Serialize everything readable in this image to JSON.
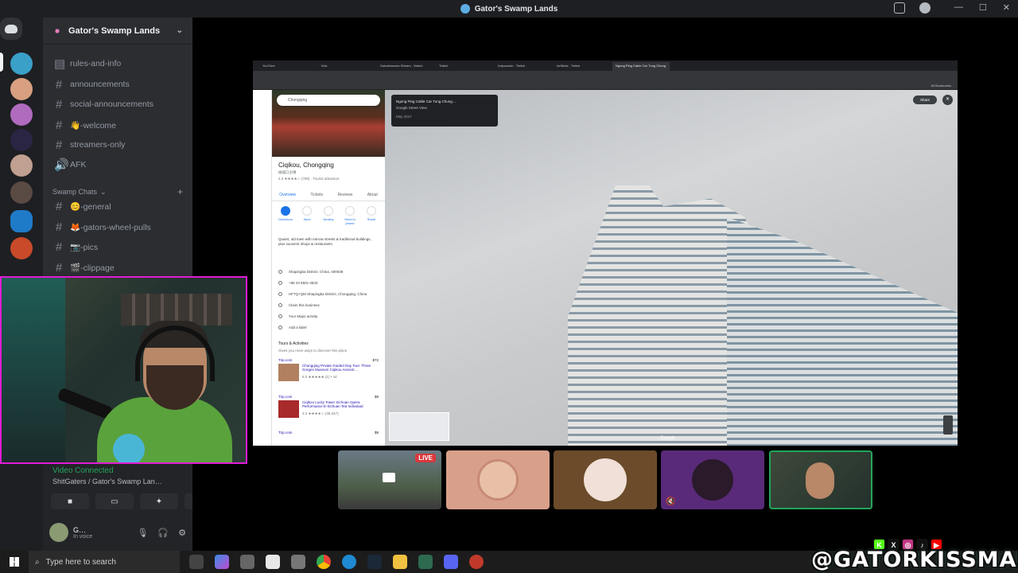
{
  "window": {
    "title": "Gator's Swamp Lands",
    "controls": [
      "—",
      "☐",
      "✕"
    ]
  },
  "server": {
    "name": "Gator's Swamp Lands"
  },
  "channels": [
    {
      "name": "rules-and-info",
      "icon": "hash"
    },
    {
      "name": "announcements",
      "icon": "hash"
    },
    {
      "name": "social-announcements",
      "icon": "hash"
    },
    {
      "name": "👋-welcome",
      "icon": "hash"
    },
    {
      "name": "streamers-only",
      "icon": "hash"
    },
    {
      "name": "AFK",
      "icon": "speaker"
    }
  ],
  "category": {
    "name": "Swamp Chats",
    "add": "+"
  },
  "category_channels": [
    {
      "name": "😊-general"
    },
    {
      "name": "🦊-gators-wheel-pulls"
    },
    {
      "name": "📷-pics"
    },
    {
      "name": "🎬-clippage"
    }
  ],
  "voice": {
    "status": "Video Connected",
    "location": "ShitGaters / Gator's Swamp Lan…",
    "user_name": "G…",
    "user_status": "In voice"
  },
  "browser": {
    "tabs": [
      "YouTube",
      "Kick",
      "Gatorkissman Stream - Watch",
      "Twitch",
      "hotpoussin - Twitch",
      "lurNkidz - Twitch",
      "Ngong Ping Cable Car Tung Chung"
    ],
    "bookmarks_hint": "All Bookmarks"
  },
  "maps": {
    "search_value": "Chongqing",
    "place_title": "Ciqikou, Chongqing",
    "place_subtitle": "磁器口古镇",
    "rating": "4.3 ★★★★☆ (789)",
    "category": "Tourist attraction",
    "tabs": [
      "Overview",
      "Tickets",
      "Reviews",
      "About"
    ],
    "actions": [
      "Directions",
      "Save",
      "Nearby",
      "Send to phone",
      "Share"
    ],
    "description": "Quaint, old town with narrow streets & traditional buildings, plus souvenir shops & restaurants.",
    "info": [
      "Shapingba District, China, 400038",
      "+86 23 6501 0633",
      "HF7Q+QM Shapingba District, Chongqing, China",
      "Claim this business",
      "Your Maps activity",
      "Add a label"
    ],
    "tours_header": "Tours & Activities",
    "tours_hint": "Gives you more ways to discover this place",
    "tours": [
      {
        "site": "Trip.com",
        "price": "$72",
        "title": "Chongqing Private Guided Day Tour: Three Gorges Museum Ciqikou Ancient…",
        "rating": "5.0 ★★★★★ (1) • 4d"
      },
      {
        "site": "Trip.com",
        "price": "$8",
        "title": "Ciqikou Lucky Tower Sichuan Opera Performance E-Sichuan Tea Individual",
        "rating": "4.3 ★★★★☆ (36,347)"
      },
      {
        "site": "Trip.com",
        "price": "$9",
        "title": "",
        "rating": ""
      }
    ]
  },
  "streetview": {
    "info_title": "Ngong Ping Cable Car Tung Chung…",
    "info_sub": "Google Street View",
    "info_date": "May 2017",
    "share_label": "Share",
    "close": "✕",
    "watermark": "Google"
  },
  "tiles": [
    {
      "label": "LIVE",
      "live": true
    },
    {
      "live": false
    },
    {
      "live": false
    },
    {
      "live": false
    },
    {
      "live": false,
      "speaking": true
    }
  ],
  "taskbar": {
    "search_placeholder": "Type here to search"
  },
  "brand": {
    "handle": "@GATORKISSMAN"
  },
  "colors": {
    "accent": "#5865f2",
    "webcam_border": "#e01bd4",
    "voice_green": "#23a55a",
    "live_red": "#da373c"
  }
}
